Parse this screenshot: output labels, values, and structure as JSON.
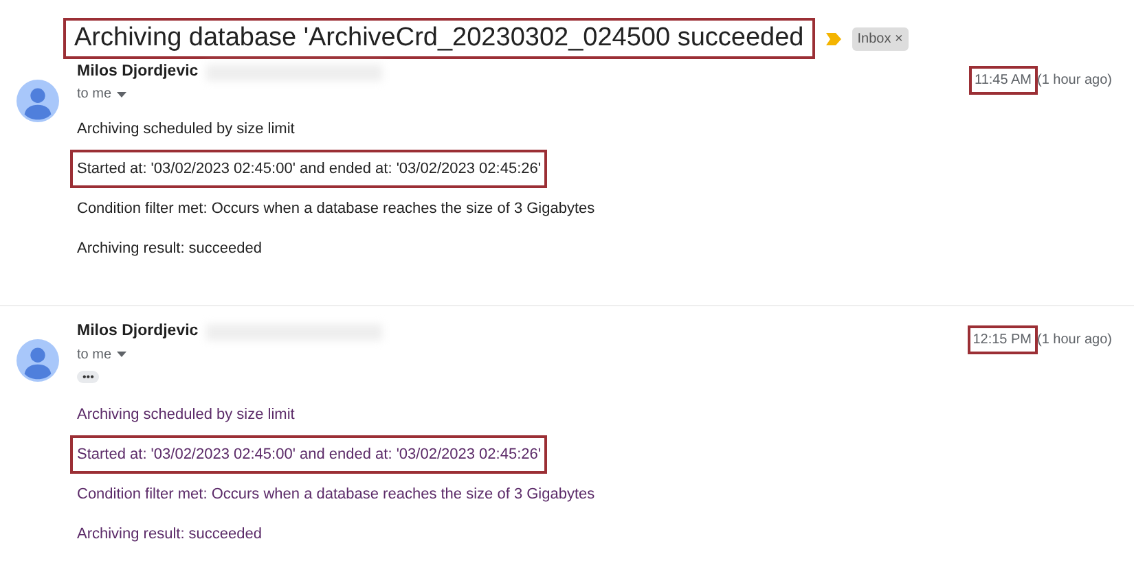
{
  "subject": {
    "text": "Archiving database 'ArchiveCrd_20230302_024500 succeeded",
    "highlighted": true
  },
  "label": {
    "text": "Inbox",
    "remove": "×"
  },
  "messages": [
    {
      "sender": "Milos Djordjevic",
      "recipient": "to me",
      "time": {
        "text": "11:45 AM",
        "highlighted": true
      },
      "relative_time": "(1 hour ago)",
      "trimmed": false,
      "lines": [
        {
          "text": "Archiving scheduled by size limit",
          "highlighted": false
        },
        {
          "text": "Started at: '03/02/2023 02:45:00' and ended at: '03/02/2023 02:45:26'",
          "highlighted": true
        },
        {
          "text": "Condition filter met: Occurs when a database reaches the size of 3 Gigabytes",
          "highlighted": false
        },
        {
          "text": "Archiving result: succeeded",
          "highlighted": false
        }
      ]
    },
    {
      "sender": "Milos Djordjevic",
      "recipient": "to me",
      "time": {
        "text": "12:15 PM",
        "highlighted": true
      },
      "relative_time": "(1 hour ago)",
      "trimmed": true,
      "trimmed_marker": "•••",
      "lines": [
        {
          "text": "Archiving scheduled by size limit",
          "highlighted": false
        },
        {
          "text": "Started at: '03/02/2023 02:45:00' and ended at: '03/02/2023 02:45:26'",
          "highlighted": true
        },
        {
          "text": "Condition filter met: Occurs when a database reaches the size of 3 Gigabytes",
          "highlighted": false
        },
        {
          "text": "Archiving result: succeeded",
          "highlighted": false
        }
      ]
    }
  ]
}
